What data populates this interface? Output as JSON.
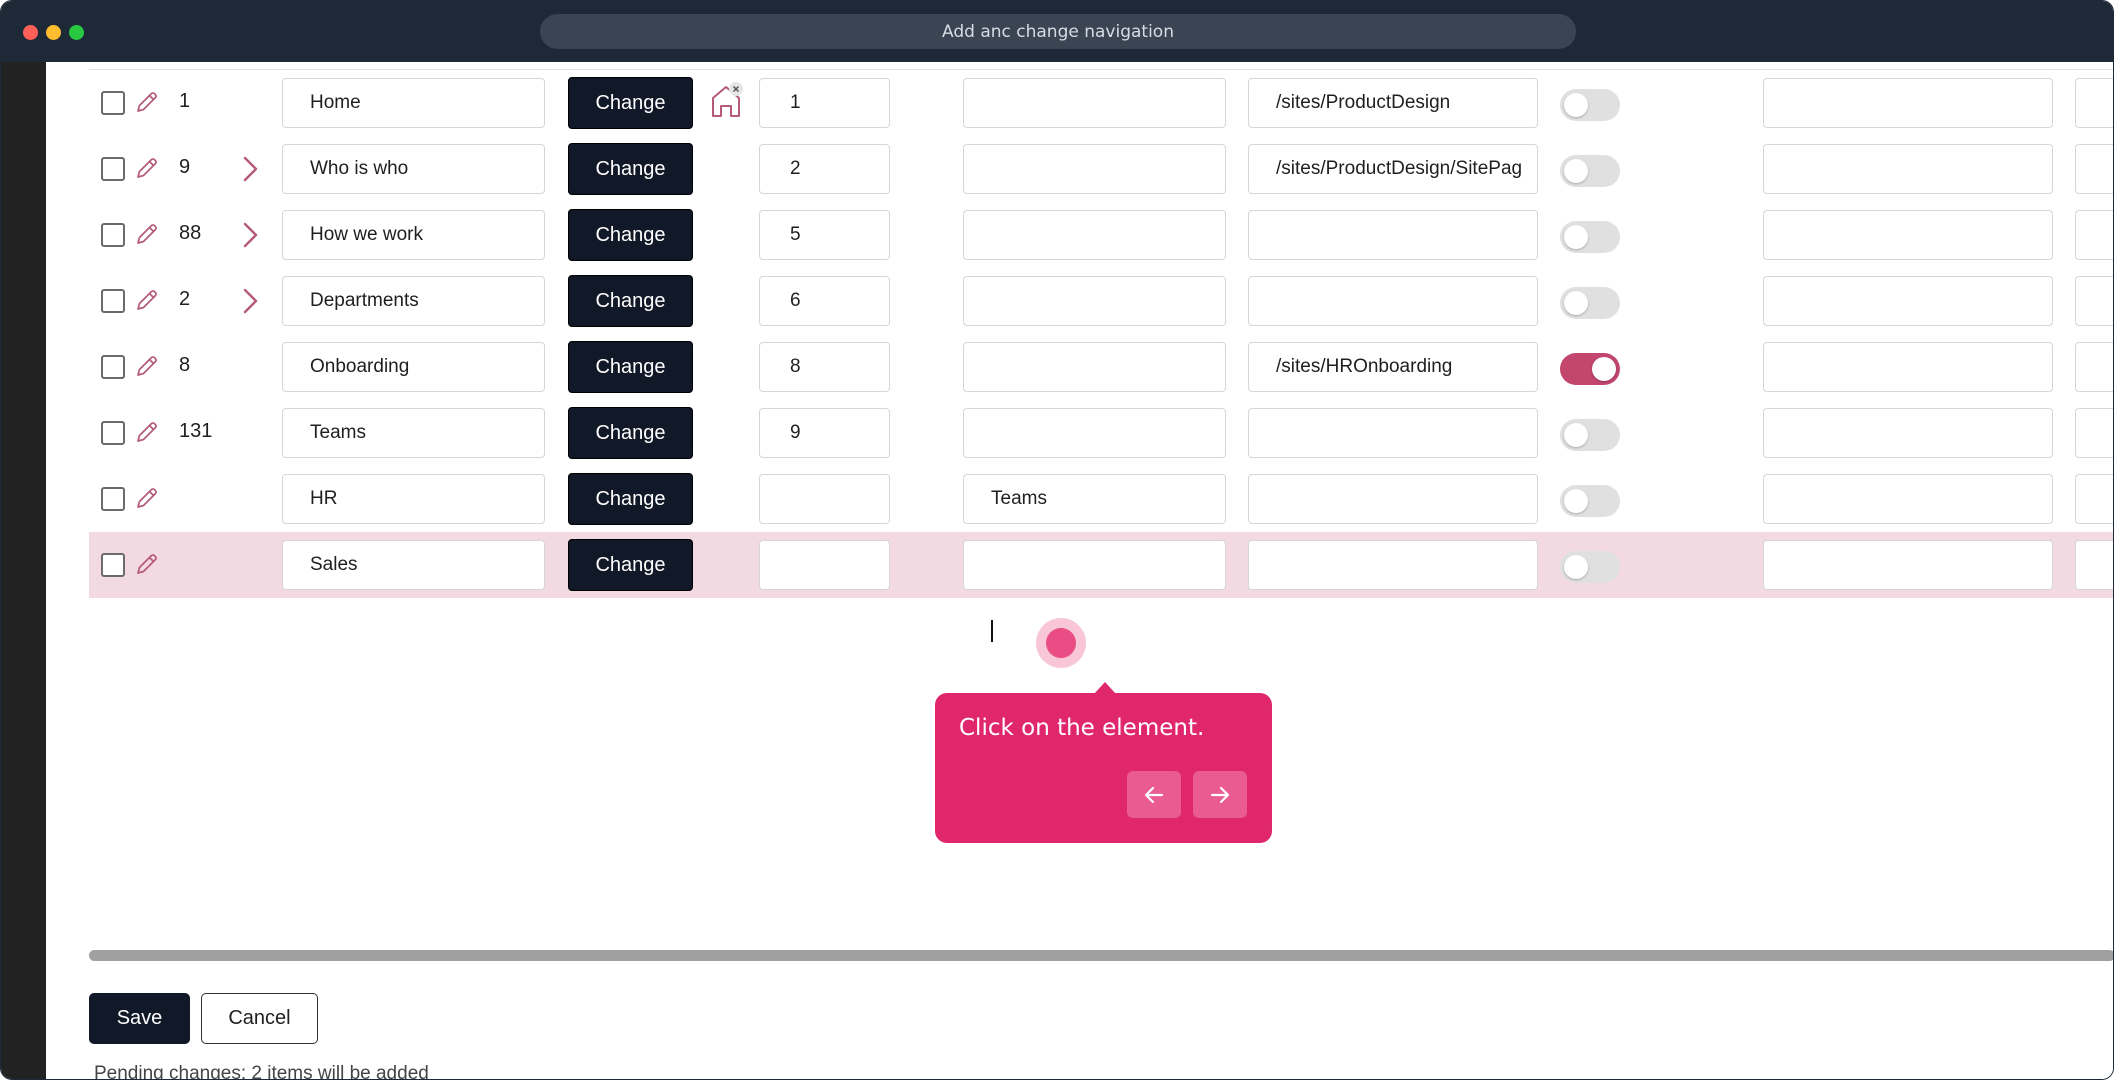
{
  "window": {
    "url_title": "Add anc change navigation"
  },
  "rows": [
    {
      "number": "1",
      "title": "Home",
      "change_label": "Change",
      "order": "1",
      "parent": "",
      "url": "/sites/ProductDesign",
      "toggle_on": false,
      "has_chevron": false,
      "has_home_icon": true
    },
    {
      "number": "9",
      "title": "Who is who",
      "change_label": "Change",
      "order": "2",
      "parent": "",
      "url": "/sites/ProductDesign/SitePag",
      "toggle_on": false,
      "has_chevron": true,
      "has_home_icon": false
    },
    {
      "number": "88",
      "title": "How we work",
      "change_label": "Change",
      "order": "5",
      "parent": "",
      "url": "",
      "toggle_on": false,
      "has_chevron": true,
      "has_home_icon": false
    },
    {
      "number": "2",
      "title": "Departments",
      "change_label": "Change",
      "order": "6",
      "parent": "",
      "url": "",
      "toggle_on": false,
      "has_chevron": true,
      "has_home_icon": false
    },
    {
      "number": "8",
      "title": "Onboarding",
      "change_label": "Change",
      "order": "8",
      "parent": "",
      "url": "/sites/HROnboarding",
      "toggle_on": true,
      "has_chevron": false,
      "has_home_icon": false
    },
    {
      "number": "131",
      "title": "Teams",
      "change_label": "Change",
      "order": "9",
      "parent": "",
      "url": "",
      "toggle_on": false,
      "has_chevron": false,
      "has_home_icon": false
    },
    {
      "number": "",
      "title": "HR",
      "change_label": "Change",
      "order": "",
      "parent": "Teams",
      "url": "",
      "toggle_on": false,
      "has_chevron": false,
      "has_home_icon": false
    },
    {
      "number": "",
      "title": "Sales",
      "change_label": "Change",
      "order": "",
      "parent": "",
      "url": "",
      "toggle_on": false,
      "has_chevron": false,
      "has_home_icon": false,
      "highlighted": true
    }
  ],
  "tooltip": {
    "text": "Click on the element.",
    "prev_icon": "arrow-left-icon",
    "next_icon": "arrow-right-icon"
  },
  "footer": {
    "save_label": "Save",
    "cancel_label": "Cancel",
    "pending_text": "Pending changes: 2 items will be added"
  },
  "colors": {
    "accent": "#c2466e",
    "tooltip": "#e0276e",
    "dark_button": "#111827",
    "highlight_row": "#f3d9e1"
  }
}
